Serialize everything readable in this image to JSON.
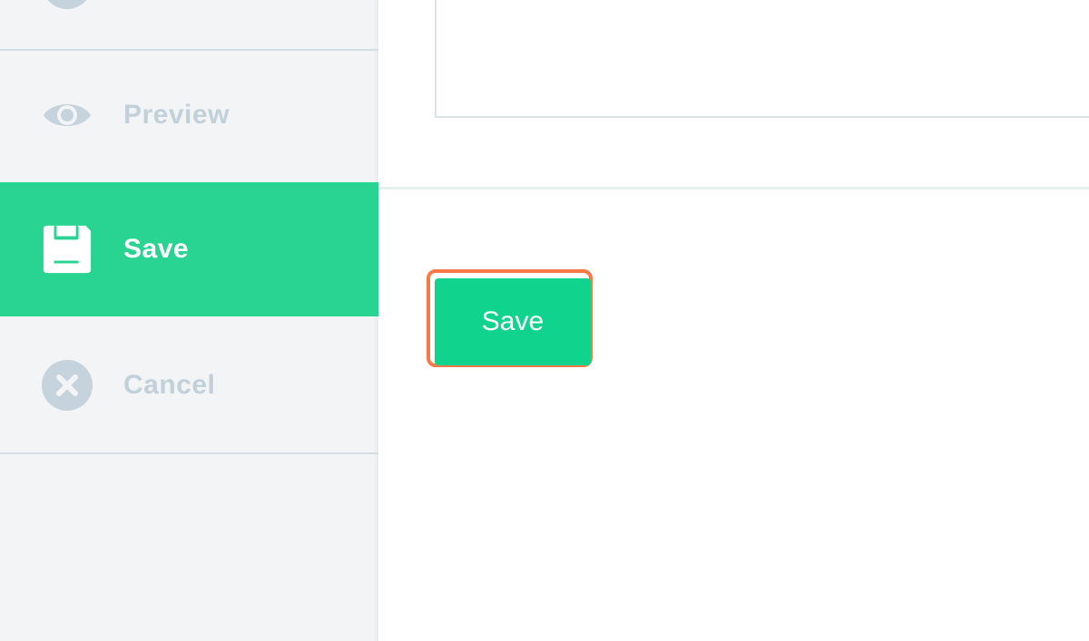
{
  "sidebar": {
    "items": [
      {
        "label": "Preview",
        "icon": "eye-icon",
        "active": false
      },
      {
        "label": "Save",
        "icon": "floppy-disk-icon",
        "active": true
      },
      {
        "label": "Cancel",
        "icon": "x-circle-icon",
        "active": false
      }
    ]
  },
  "main": {
    "save_button_label": "Save"
  },
  "colors": {
    "accent": "#29d391",
    "button": "#10d38e",
    "highlight_outline": "#f57a47",
    "muted_text": "#c2d0da",
    "sidebar_bg": "#f3f4f5"
  }
}
